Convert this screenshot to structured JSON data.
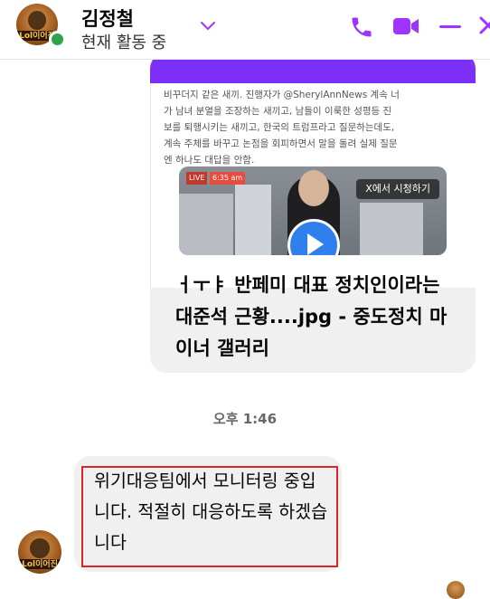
{
  "header": {
    "name": "김정철",
    "status": "현재 활동 중",
    "avatar_text": "Lol이어진",
    "accent_color": "#a033ff",
    "icons": [
      "phone-icon",
      "video-call-icon",
      "minimize-icon",
      "close-icon"
    ]
  },
  "link_card": {
    "preview_text": "비꾸더지 같은 새끼. 진행자가 @SherylAnnNews 계속 너\n가 남녀 분열을 조장하는 새끼고, 남들이 이룩한 성평등 진\n보를 퇴행시키는 새끼고, 한국의 트럼프라고 질문하는데도,\n계속 주체를 바꾸고 논점을 회피하면서 말을 돌려 실제 질문\n엔 하나도 대답을 안함.",
    "video_badge": "LIVE",
    "video_time": "6:35 am",
    "watch_button": "X에서 시청하기",
    "title": "ㅓㅜㅑ 반페미 대표 정치인이라는 대준석 근황....jpg - 중도정치 마이너 갤러리"
  },
  "timestamp": "오후 1:46",
  "message": {
    "text": "위기대응팀에서 모니터링 중입니다. 적절히 대응하도록 하겠습니다",
    "avatar_text": "Lol이어진"
  }
}
